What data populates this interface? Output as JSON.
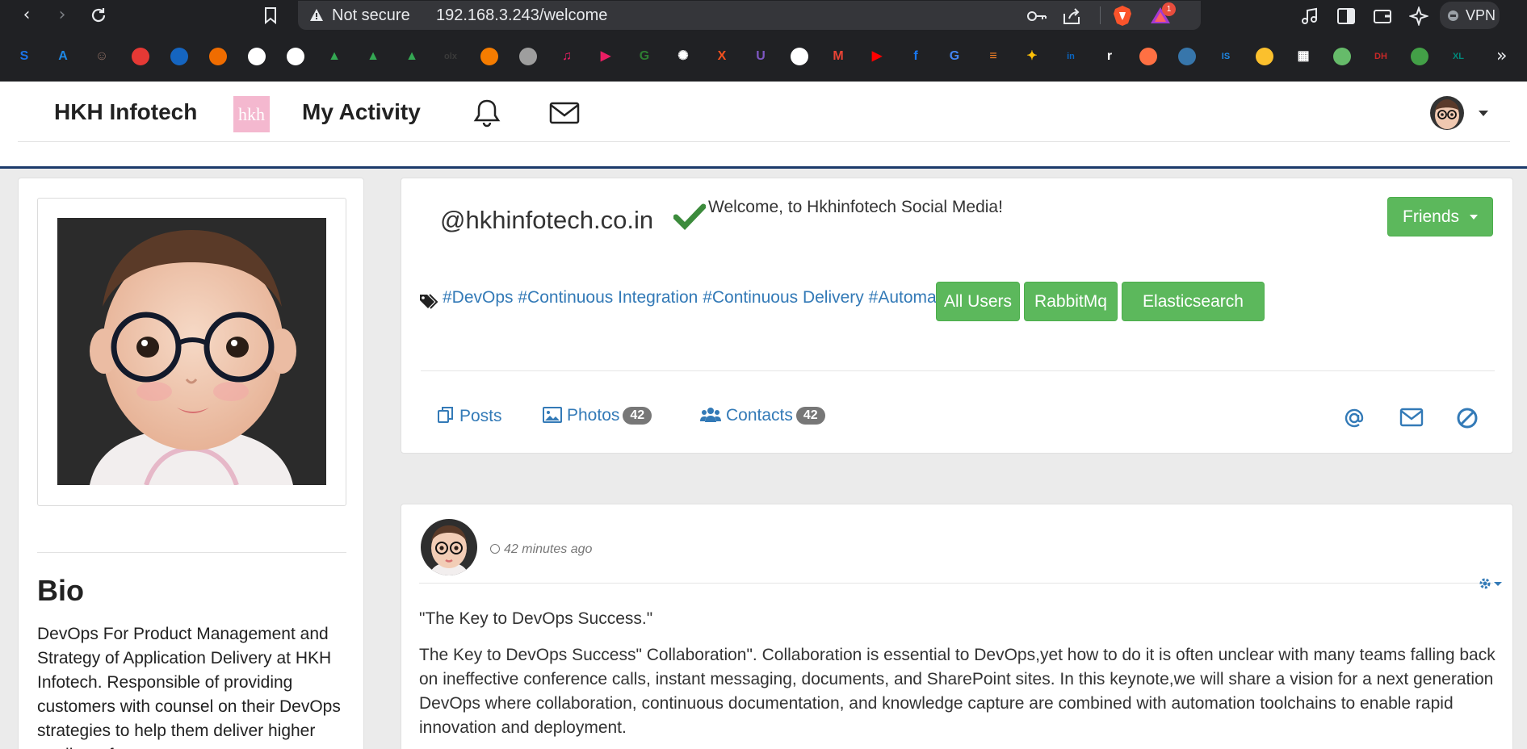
{
  "browser": {
    "security_label": "Not secure",
    "url": "192.168.3.243/welcome",
    "rewards_count": "1",
    "vpn_label": "VPN",
    "nav_icons": [
      "back-icon",
      "forward-icon",
      "reload-icon",
      "bookmark-icon"
    ],
    "toolbar_icons": [
      "password-key-icon",
      "share-icon",
      "brave-shield-icon",
      "brave-rewards-icon",
      "music-icon",
      "sidebar-icon",
      "wallet-icon",
      "leo-ai-icon"
    ]
  },
  "bookmarks": [
    {
      "name": "bookmark-s",
      "glyph": "S",
      "color": "#1a73e8"
    },
    {
      "name": "bookmark-azure",
      "glyph": "A",
      "color": "#1e88e5"
    },
    {
      "name": "bookmark-avatar",
      "glyph": "☺",
      "color": "#8d6e63"
    },
    {
      "name": "bookmark-red-ball",
      "glyph": "",
      "color": "#e53935"
    },
    {
      "name": "bookmark-circle-blue",
      "glyph": "",
      "color": "#1565c0"
    },
    {
      "name": "bookmark-cloud",
      "glyph": "",
      "color": "#ef6c00"
    },
    {
      "name": "bookmark-github-1",
      "glyph": "",
      "color": "#ffffff"
    },
    {
      "name": "bookmark-github-2",
      "glyph": "",
      "color": "#ffffff"
    },
    {
      "name": "bookmark-drive-1",
      "glyph": "▲",
      "color": "#34a853"
    },
    {
      "name": "bookmark-drive-2",
      "glyph": "▲",
      "color": "#34a853"
    },
    {
      "name": "bookmark-drive-3",
      "glyph": "▲",
      "color": "#34a853"
    },
    {
      "name": "bookmark-olx",
      "glyph": "olx",
      "color": "#3a3a3a"
    },
    {
      "name": "bookmark-box",
      "glyph": "",
      "color": "#f57c00"
    },
    {
      "name": "bookmark-globe",
      "glyph": "",
      "color": "#9e9e9e"
    },
    {
      "name": "bookmark-music",
      "glyph": "♫",
      "color": "#e91e63"
    },
    {
      "name": "bookmark-play",
      "glyph": "▶",
      "color": "#e91e63"
    },
    {
      "name": "bookmark-gfg",
      "glyph": "G",
      "color": "#2e7d32"
    },
    {
      "name": "bookmark-openai",
      "glyph": "✺",
      "color": "#ffffff"
    },
    {
      "name": "bookmark-x",
      "glyph": "X",
      "color": "#f4511e"
    },
    {
      "name": "bookmark-u",
      "glyph": "U",
      "color": "#7e57c2"
    },
    {
      "name": "bookmark-github-3",
      "glyph": "",
      "color": "#ffffff"
    },
    {
      "name": "bookmark-gmail",
      "glyph": "M",
      "color": "#ea4335"
    },
    {
      "name": "bookmark-youtube",
      "glyph": "▶",
      "color": "#ff0000"
    },
    {
      "name": "bookmark-facebook",
      "glyph": "f",
      "color": "#1877f2"
    },
    {
      "name": "bookmark-translate",
      "glyph": "G",
      "color": "#4285f4"
    },
    {
      "name": "bookmark-stack",
      "glyph": "≡",
      "color": "#f48024"
    },
    {
      "name": "bookmark-rocket",
      "glyph": "✦",
      "color": "#ffc107"
    },
    {
      "name": "bookmark-linkedin",
      "glyph": "in",
      "color": "#0a66c2"
    },
    {
      "name": "bookmark-r",
      "glyph": "r",
      "color": "#ffffff"
    },
    {
      "name": "bookmark-fire",
      "glyph": "",
      "color": "#ff7043"
    },
    {
      "name": "bookmark-python",
      "glyph": "",
      "color": "#3776ab"
    },
    {
      "name": "bookmark-is",
      "glyph": "IS",
      "color": "#1e88e5"
    },
    {
      "name": "bookmark-dots",
      "glyph": "",
      "color": "#fbc02d"
    },
    {
      "name": "bookmark-qr",
      "glyph": "▦",
      "color": "#ffffff"
    },
    {
      "name": "bookmark-people",
      "glyph": "",
      "color": "#66bb6a"
    },
    {
      "name": "bookmark-dh",
      "glyph": "DH",
      "color": "#c62828"
    },
    {
      "name": "bookmark-chat",
      "glyph": "",
      "color": "#43a047"
    },
    {
      "name": "bookmark-xl",
      "glyph": "XL",
      "color": "#00897b"
    }
  ],
  "navbar": {
    "brand": "HKH Infotech",
    "logo_text": "hkh",
    "activity_label": "My Activity",
    "icons": [
      "bell-icon",
      "envelope-icon"
    ]
  },
  "profile": {
    "bio_title": "Bio",
    "bio_text": "DevOps For Product Management and Strategy of Application Delivery at HKH Infotech. Responsible of providing customers with counsel on their DevOps strategies to help them deliver higher quality software"
  },
  "header": {
    "handle": "@hkhinfotech.co.in",
    "welcome": "Welcome, to Hkhinfotech Social Media!",
    "friends_button": "Friends",
    "tags_text": "#DevOps #Continuous Integration #Continuous Delivery #Automation",
    "tag_buttons": [
      "All Users",
      "RabbitMq",
      "Elasticsearch"
    ],
    "tabs": {
      "posts": "Posts",
      "photos": "Photos",
      "photos_count": "42",
      "contacts": "Contacts",
      "contacts_count": "42"
    },
    "action_icons": [
      "at-icon",
      "envelope-icon",
      "block-icon"
    ]
  },
  "post": {
    "time": "42 minutes ago",
    "title": "\"The Key to DevOps Success.\"",
    "body": "The Key to DevOps Success\" Collaboration\". Collaboration is essential to DevOps,yet how to do it is often unclear with many teams falling back on ineffective conference calls, instant messaging, documents, and SharePoint sites. In this keynote,we will share a vision for a next generation DevOps where collaboration, continuous documentation, and knowledge capture are combined with automation toolchains to enable rapid innovation and deployment."
  },
  "colors": {
    "success": "#5cb85c",
    "link": "#337ab7",
    "browser_dark": "#202124"
  }
}
